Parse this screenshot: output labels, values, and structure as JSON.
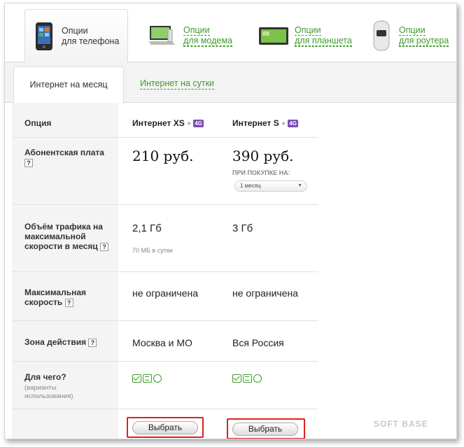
{
  "categories": [
    {
      "line1": "Опции",
      "line2": "для телефона",
      "active": true,
      "icon": "phone-icon"
    },
    {
      "line1": "Опции",
      "line2": "для модема",
      "active": false,
      "icon": "modem-icon"
    },
    {
      "line1": "Опции",
      "line2": "для планшета",
      "active": false,
      "icon": "tablet-icon"
    },
    {
      "line1": "Опции",
      "line2": "для роутера",
      "active": false,
      "icon": "router-icon"
    }
  ],
  "subtabs": {
    "active": "Интернет на месяц",
    "other": "Интернет на сутки"
  },
  "table": {
    "header_label": "Опция",
    "plans": [
      {
        "name": "Интернет XS",
        "plus": "+",
        "badge": "4G"
      },
      {
        "name": "Интернет S",
        "plus": "+",
        "badge": "4G"
      }
    ],
    "rows": {
      "fee": {
        "label": "Абонентская плата",
        "help": "?",
        "values": [
          "210 руб.",
          "390 руб."
        ],
        "purchase_label": "ПРИ ПОКУПКЕ НА:",
        "period_select": "1 месяц"
      },
      "traffic": {
        "label": "Объём трафика на максимальной скорости в месяц",
        "help": "?",
        "values": [
          "2,1 Гб",
          "3 Гб"
        ],
        "note": "70 МБ в сутки"
      },
      "speed": {
        "label": "Максимальная скорость",
        "help": "?",
        "values": [
          "не ограничена",
          "не ограничена"
        ]
      },
      "zone": {
        "label": "Зона действия",
        "help": "?",
        "values": [
          "Москва и МО",
          "Вся Россия"
        ]
      },
      "usage": {
        "label": "Для чего?",
        "sub": "(варианты использования)"
      }
    },
    "select_button": "Выбрать"
  },
  "watermark": "SOFT BASE",
  "colors": {
    "accent": "#3e9b29",
    "badge": "#7b4bb2",
    "highlight": "#e02020"
  }
}
